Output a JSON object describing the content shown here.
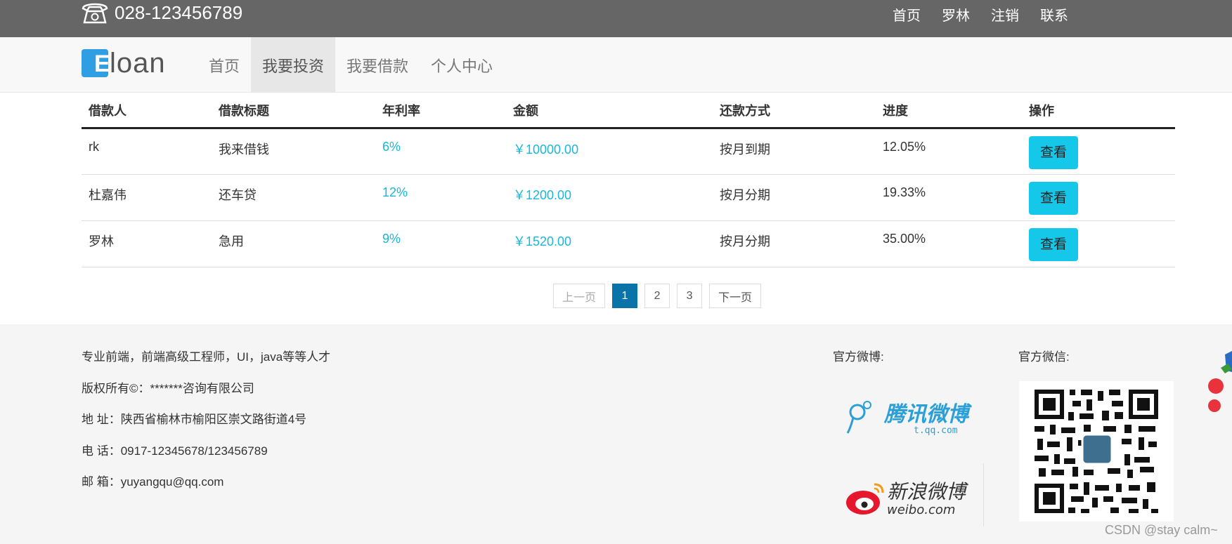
{
  "topbar": {
    "phone": "028-123456789",
    "links": [
      "首页",
      "罗林",
      "注销",
      "联系"
    ]
  },
  "brand": {
    "logo_letter": "E",
    "logo_text": "loan"
  },
  "nav": {
    "items": [
      {
        "label": "首页",
        "active": false
      },
      {
        "label": "我要投资",
        "active": true
      },
      {
        "label": "我要借款",
        "active": false
      },
      {
        "label": "个人中心",
        "active": false
      }
    ]
  },
  "table": {
    "headers": [
      "借款人",
      "借款标题",
      "年利率",
      "金额",
      "还款方式",
      "进度",
      "操作"
    ],
    "rows": [
      {
        "borrower": "rk",
        "title": "我来借钱",
        "rate": "6%",
        "amount": "￥10000.00",
        "method": "按月到期",
        "progress": "12.05%",
        "action": "查看"
      },
      {
        "borrower": "杜嘉伟",
        "title": "还车贷",
        "rate": "12%",
        "amount": "￥1200.00",
        "method": "按月分期",
        "progress": "19.33%",
        "action": "查看"
      },
      {
        "borrower": "罗林",
        "title": "急用",
        "rate": "9%",
        "amount": "￥1520.00",
        "method": "按月分期",
        "progress": "35.00%",
        "action": "查看"
      }
    ]
  },
  "pagination": {
    "prev": "上一页",
    "pages": [
      "1",
      "2",
      "3"
    ],
    "current": "1",
    "next": "下一页"
  },
  "footer": {
    "lines": [
      "专业前端，前端高级工程师，UI，java等等人才",
      "版权所有©：*******咨询有限公司",
      "地 址：陕西省榆林市榆阳区崇文路街道4号",
      "电 话：0917-12345678/123456789",
      "邮 箱：yuyangqu@qq.com"
    ],
    "weibo_label": "官方微博:",
    "wechat_label": "官方微信:",
    "tencent_weibo": "腾讯微博",
    "tencent_domain": "t.qq.com",
    "sina_weibo": "新浪微博",
    "sina_domain": "weibo.com"
  },
  "watermark": "CSDN @stay calm~",
  "colors": {
    "topbar": "#666666",
    "accent_cyan": "#15c7e8",
    "pager_active": "#0a73a8",
    "logo_blue": "#2f9ee3"
  }
}
